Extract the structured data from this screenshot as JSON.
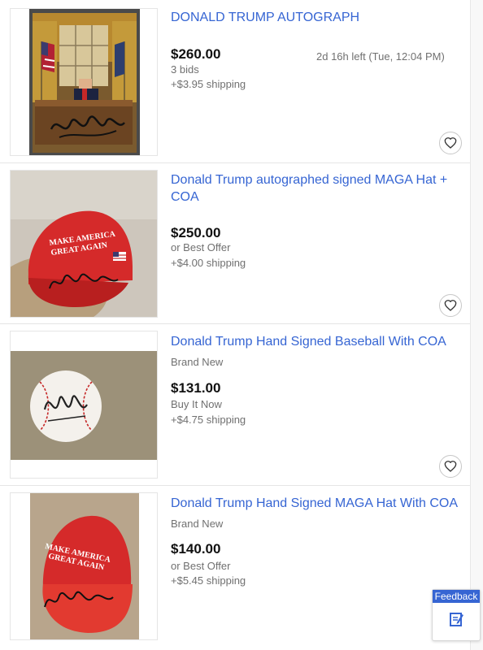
{
  "listings": [
    {
      "title": "DONALD TRUMP AUTOGRAPH",
      "price": "$260.00",
      "bids": "3 bids",
      "shipping": "+$3.95 shipping",
      "time_left": "2d 16h left (Tue, 12:04 PM)",
      "image_icon": "oval-office-photo"
    },
    {
      "title": "Donald Trump autographed signed MAGA Hat + COA",
      "price": "$250.00",
      "buying_format": "or Best Offer",
      "shipping": "+$4.00 shipping",
      "hat_text_line1": "MAKE AMERICA",
      "hat_text_line2": "GREAT AGAIN",
      "image_icon": "red-maga-hat-photo"
    },
    {
      "title": "Donald Trump Hand Signed Baseball With COA",
      "condition": "Brand New",
      "price": "$131.00",
      "buying_format": "Buy It Now",
      "shipping": "+$4.75 shipping",
      "image_icon": "signed-baseball-photo"
    },
    {
      "title": "Donald Trump Hand Signed MAGA Hat With COA",
      "condition": "Brand New",
      "price": "$140.00",
      "buying_format": "or Best Offer",
      "shipping": "+$5.45 shipping",
      "hat_text_line1": "MAKE AMERICA",
      "hat_text_line2": "GREAT AGAIN",
      "image_icon": "red-maga-hat-photo"
    }
  ],
  "feedback": {
    "label": "Feedback",
    "icon": "edit-note-icon"
  },
  "colors": {
    "link": "#3665d3",
    "price": "#111111",
    "meta": "#707070",
    "hat_red": "#d52a2a"
  }
}
